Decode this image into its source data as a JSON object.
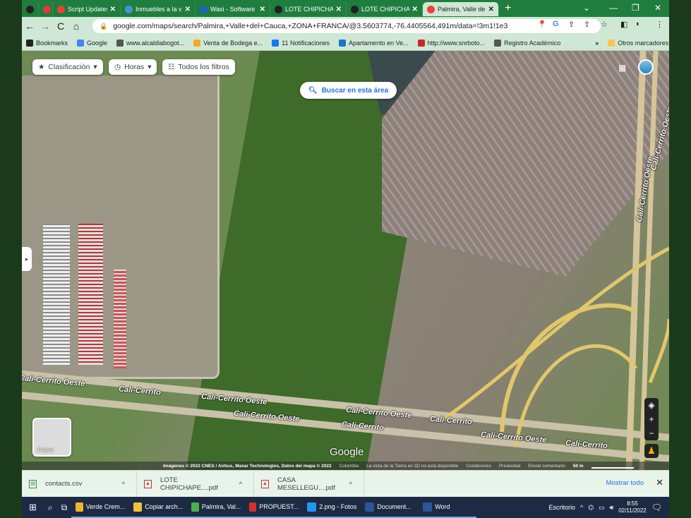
{
  "browser": {
    "tabs": [
      {
        "label": "",
        "icon": "chrome-icon",
        "color": "#202124"
      },
      {
        "label": "",
        "icon": "ublock-icon",
        "color": "#e53935"
      },
      {
        "label": "Script Updates A",
        "icon": "gmail-icon",
        "color": "#ea4335"
      },
      {
        "label": "Inmuebles a la v",
        "icon": "feather-icon",
        "color": "#4a90d9"
      },
      {
        "label": "Wasi - Software",
        "icon": "wasi-icon",
        "color": "#1565c0"
      },
      {
        "label": "LOTE CHIPICHAP",
        "icon": "chrome-icon",
        "color": "#202124"
      },
      {
        "label": "LOTE CHIPICHAP",
        "icon": "chrome-icon",
        "color": "#202124"
      },
      {
        "label": "Palmira, Valle del",
        "icon": "maps-pin-icon",
        "color": "#ea4335",
        "active": true
      }
    ],
    "new_tab": "+",
    "url": "google.com/maps/search/Palmira,+Valle+del+Cauca,+ZONA+FRANCA/@3.5603774,-76.4405564,491m/data=!3m1!1e3",
    "bookmarks": [
      {
        "label": "Bookmarks",
        "icon": "star-icon",
        "color": "#202124"
      },
      {
        "label": "Google",
        "icon": "google-icon",
        "color": "#4285f4"
      },
      {
        "label": "www.alcaldiabogot...",
        "icon": "shield-icon",
        "color": "#555"
      },
      {
        "label": "Venta de Bodega e...",
        "icon": "folder-icon",
        "color": "#f9a825"
      },
      {
        "label": "11 Notificaciones",
        "icon": "facebook-icon",
        "color": "#1877f2"
      },
      {
        "label": "Apartamento en Ve...",
        "icon": "site-icon",
        "color": "#1976d2"
      },
      {
        "label": "http://www.snrboto...",
        "icon": "doc-icon",
        "color": "#c62828"
      },
      {
        "label": "Registro Académico",
        "icon": "chart-icon",
        "color": "#555"
      }
    ],
    "bookmarks_more": "»",
    "other_bookmarks": "Otros marcadores"
  },
  "map": {
    "chips": [
      "Clasificación",
      "Horas",
      "Todos los filtros"
    ],
    "search_area": "Buscar en esta área",
    "layers_label": "Capas",
    "google_logo": "Google",
    "credits": "Imágenes © 2022 CNES / Airbus, Maxar Technologies, Datos del mapa © 2022",
    "credits_links": [
      "Colombia",
      "La vista de la Tierra en 3D no está disponible",
      "Condiciones",
      "Privacidad",
      "Enviar comentario"
    ],
    "scale": "50 m",
    "road_labels": [
      {
        "text": "Cali-Cerrito Oeste"
      },
      {
        "text": "Cali-Cerrito"
      },
      {
        "text": "Cali-Cerrito Oeste"
      },
      {
        "text": "Cali-Cerrito Oeste"
      },
      {
        "text": "Cali-Cerrito Oeste"
      },
      {
        "text": "Cali-Cerrito"
      },
      {
        "text": "Cali-Cerrito"
      },
      {
        "text": "Cali-Cerrito Oeste"
      },
      {
        "text": "Cali-Cerrito"
      },
      {
        "text": "Cali-Cerrito Oeste"
      },
      {
        "text": "Cali-Cerrito Oeste"
      }
    ]
  },
  "downloads": {
    "items": [
      {
        "name": "contacts.csv",
        "type": "csv"
      },
      {
        "name": "LOTE CHIPICHAPE....pdf",
        "type": "pdf"
      },
      {
        "name": "CASA MESELLEGU....pdf",
        "type": "pdf"
      }
    ],
    "show_all": "Mostrar todo"
  },
  "taskbar": {
    "apps": [
      {
        "label": "Verde Crem...",
        "color": "#f0b429"
      },
      {
        "label": "Copiar arch...",
        "color": "#f0c040"
      },
      {
        "label": "Palmira, Val...",
        "color": "#4caf50"
      },
      {
        "label": "PROPUEST...",
        "color": "#d32f2f"
      },
      {
        "label": "2.png - Fotos",
        "color": "#2196f3"
      },
      {
        "label": "Document...",
        "color": "#2b579a"
      },
      {
        "label": "Word",
        "color": "#2b579a"
      }
    ],
    "desktop": "Escritorio",
    "time": "8:55",
    "date": "02/11/2022"
  }
}
